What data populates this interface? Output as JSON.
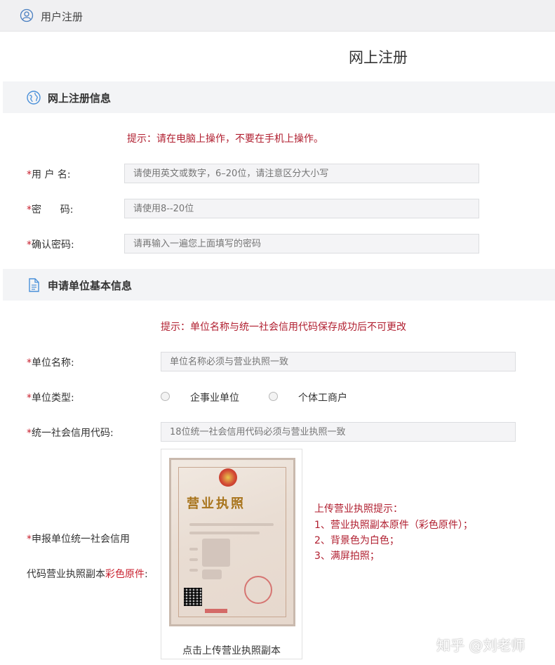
{
  "topbar": {
    "icon": "user-icon",
    "title": "用户注册"
  },
  "page_title": "网上注册",
  "sections": {
    "register": {
      "icon": "globe-icon",
      "title": "网上注册信息"
    },
    "unit": {
      "icon": "document-icon",
      "title": "申请单位基本信息"
    }
  },
  "register": {
    "hint": "提示：请在电脑上操作，不要在手机上操作。",
    "username": {
      "label": "用 户 名:",
      "placeholder": "请使用英文或数字，6–20位，请注意区分大小写"
    },
    "password": {
      "label": "密      码:",
      "placeholder": "请使用8--20位"
    },
    "confirm": {
      "label": "确认密码:",
      "placeholder": "请再输入一遍您上面填写的密码"
    }
  },
  "unit": {
    "hint": "提示：单位名称与统一社会信用代码保存成功后不可更改",
    "name": {
      "label": "单位名称:",
      "placeholder": "单位名称必须与营业执照一致"
    },
    "type": {
      "label": "单位类型:",
      "options": [
        "企事业单位",
        "个体工商户"
      ]
    },
    "credit": {
      "label": "统一社会信用代码:",
      "placeholder": "18位统一社会信用代码必须与营业执照一致"
    },
    "license": {
      "label_line1": "申报单位统一社会信用",
      "label_line2": "代码营业执照副本",
      "label_highlight": "彩色原件",
      "label_colon": ":",
      "caption": "点击上传营业执照副本",
      "image_title": "营业执照",
      "tips": [
        "上传营业执照提示：",
        "1、营业执照副本原件（彩色原件）；",
        "2、背景色为白色；",
        "3、满屏拍照；"
      ]
    }
  },
  "required_mark": "*",
  "watermark": "知乎 @刘老师",
  "colors": {
    "hint_red": "#b01e2f",
    "required_red": "#c81e2c",
    "section_bg": "#f3f4f6"
  }
}
